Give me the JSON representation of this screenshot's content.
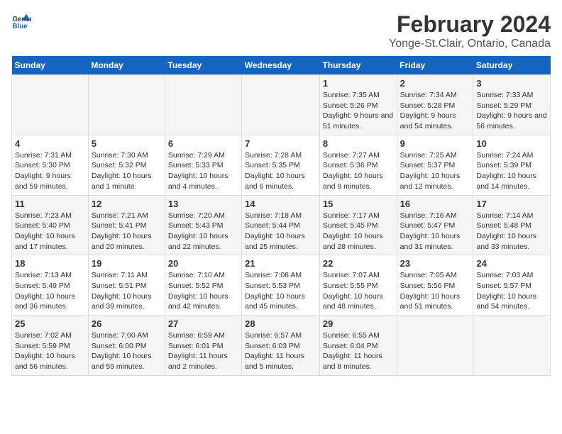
{
  "header": {
    "logo_general": "General",
    "logo_blue": "Blue",
    "title": "February 2024",
    "subtitle": "Yonge-St.Clair, Ontario, Canada"
  },
  "days_of_week": [
    "Sunday",
    "Monday",
    "Tuesday",
    "Wednesday",
    "Thursday",
    "Friday",
    "Saturday"
  ],
  "weeks": [
    {
      "row": 1,
      "cells": [
        {
          "day": "",
          "info": ""
        },
        {
          "day": "",
          "info": ""
        },
        {
          "day": "",
          "info": ""
        },
        {
          "day": "",
          "info": ""
        },
        {
          "day": "1",
          "info": "Sunrise: 7:35 AM\nSunset: 5:26 PM\nDaylight: 9 hours and 51 minutes."
        },
        {
          "day": "2",
          "info": "Sunrise: 7:34 AM\nSunset: 5:28 PM\nDaylight: 9 hours and 54 minutes."
        },
        {
          "day": "3",
          "info": "Sunrise: 7:33 AM\nSunset: 5:29 PM\nDaylight: 9 hours and 56 minutes."
        }
      ]
    },
    {
      "row": 2,
      "cells": [
        {
          "day": "4",
          "info": "Sunrise: 7:31 AM\nSunset: 5:30 PM\nDaylight: 9 hours and 59 minutes."
        },
        {
          "day": "5",
          "info": "Sunrise: 7:30 AM\nSunset: 5:32 PM\nDaylight: 10 hours and 1 minute."
        },
        {
          "day": "6",
          "info": "Sunrise: 7:29 AM\nSunset: 5:33 PM\nDaylight: 10 hours and 4 minutes."
        },
        {
          "day": "7",
          "info": "Sunrise: 7:28 AM\nSunset: 5:35 PM\nDaylight: 10 hours and 6 minutes."
        },
        {
          "day": "8",
          "info": "Sunrise: 7:27 AM\nSunset: 5:36 PM\nDaylight: 10 hours and 9 minutes."
        },
        {
          "day": "9",
          "info": "Sunrise: 7:25 AM\nSunset: 5:37 PM\nDaylight: 10 hours and 12 minutes."
        },
        {
          "day": "10",
          "info": "Sunrise: 7:24 AM\nSunset: 5:39 PM\nDaylight: 10 hours and 14 minutes."
        }
      ]
    },
    {
      "row": 3,
      "cells": [
        {
          "day": "11",
          "info": "Sunrise: 7:23 AM\nSunset: 5:40 PM\nDaylight: 10 hours and 17 minutes."
        },
        {
          "day": "12",
          "info": "Sunrise: 7:21 AM\nSunset: 5:41 PM\nDaylight: 10 hours and 20 minutes."
        },
        {
          "day": "13",
          "info": "Sunrise: 7:20 AM\nSunset: 5:43 PM\nDaylight: 10 hours and 22 minutes."
        },
        {
          "day": "14",
          "info": "Sunrise: 7:18 AM\nSunset: 5:44 PM\nDaylight: 10 hours and 25 minutes."
        },
        {
          "day": "15",
          "info": "Sunrise: 7:17 AM\nSunset: 5:45 PM\nDaylight: 10 hours and 28 minutes."
        },
        {
          "day": "16",
          "info": "Sunrise: 7:16 AM\nSunset: 5:47 PM\nDaylight: 10 hours and 31 minutes."
        },
        {
          "day": "17",
          "info": "Sunrise: 7:14 AM\nSunset: 5:48 PM\nDaylight: 10 hours and 33 minutes."
        }
      ]
    },
    {
      "row": 4,
      "cells": [
        {
          "day": "18",
          "info": "Sunrise: 7:13 AM\nSunset: 5:49 PM\nDaylight: 10 hours and 36 minutes."
        },
        {
          "day": "19",
          "info": "Sunrise: 7:11 AM\nSunset: 5:51 PM\nDaylight: 10 hours and 39 minutes."
        },
        {
          "day": "20",
          "info": "Sunrise: 7:10 AM\nSunset: 5:52 PM\nDaylight: 10 hours and 42 minutes."
        },
        {
          "day": "21",
          "info": "Sunrise: 7:08 AM\nSunset: 5:53 PM\nDaylight: 10 hours and 45 minutes."
        },
        {
          "day": "22",
          "info": "Sunrise: 7:07 AM\nSunset: 5:55 PM\nDaylight: 10 hours and 48 minutes."
        },
        {
          "day": "23",
          "info": "Sunrise: 7:05 AM\nSunset: 5:56 PM\nDaylight: 10 hours and 51 minutes."
        },
        {
          "day": "24",
          "info": "Sunrise: 7:03 AM\nSunset: 5:57 PM\nDaylight: 10 hours and 54 minutes."
        }
      ]
    },
    {
      "row": 5,
      "cells": [
        {
          "day": "25",
          "info": "Sunrise: 7:02 AM\nSunset: 5:59 PM\nDaylight: 10 hours and 56 minutes."
        },
        {
          "day": "26",
          "info": "Sunrise: 7:00 AM\nSunset: 6:00 PM\nDaylight: 10 hours and 59 minutes."
        },
        {
          "day": "27",
          "info": "Sunrise: 6:59 AM\nSunset: 6:01 PM\nDaylight: 11 hours and 2 minutes."
        },
        {
          "day": "28",
          "info": "Sunrise: 6:57 AM\nSunset: 6:03 PM\nDaylight: 11 hours and 5 minutes."
        },
        {
          "day": "29",
          "info": "Sunrise: 6:55 AM\nSunset: 6:04 PM\nDaylight: 11 hours and 8 minutes."
        },
        {
          "day": "",
          "info": ""
        },
        {
          "day": "",
          "info": ""
        }
      ]
    }
  ]
}
